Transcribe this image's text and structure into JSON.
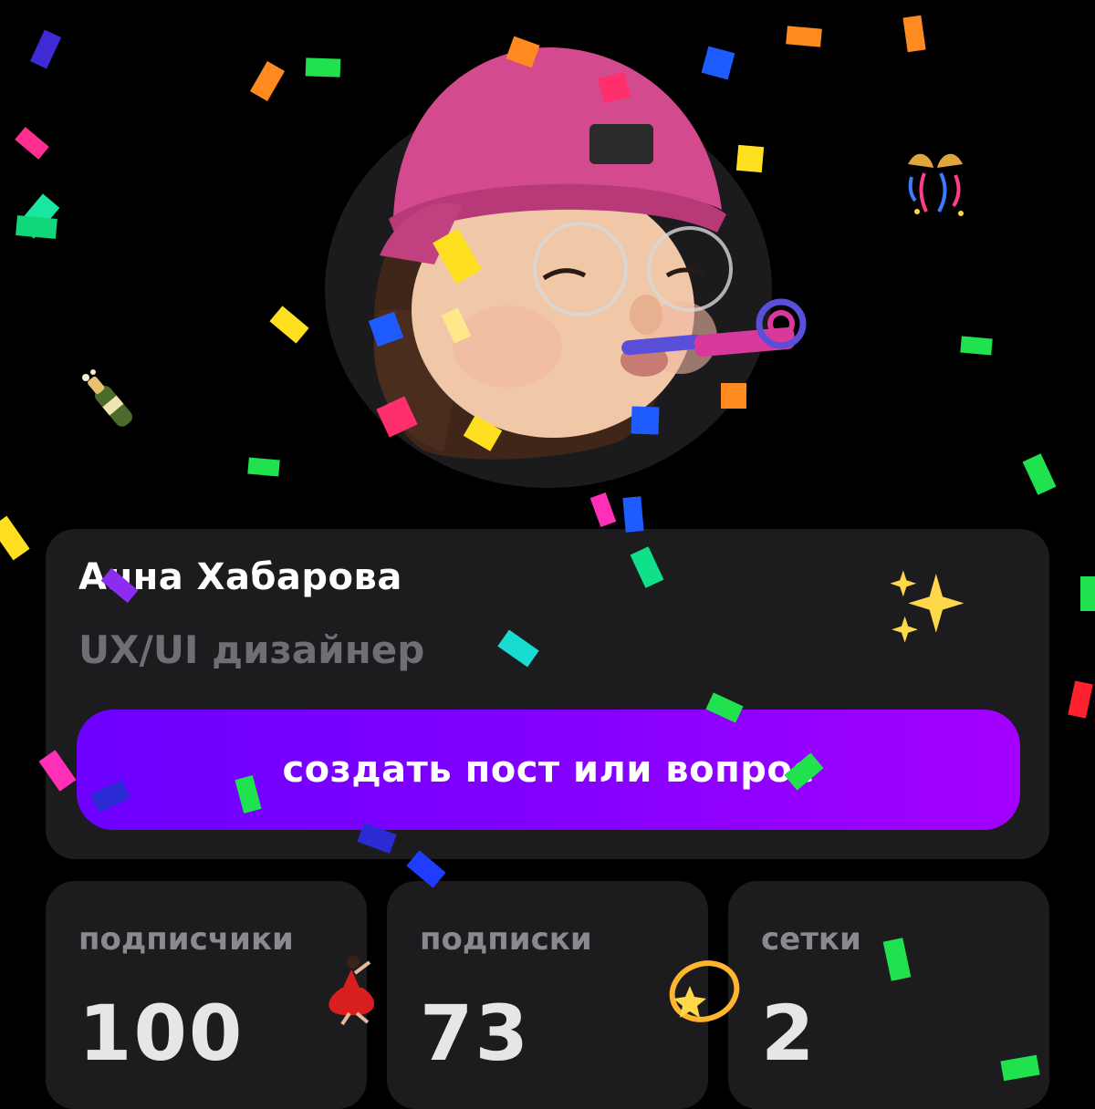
{
  "profile": {
    "name": "Анна Хабарова",
    "role": "UX/UI дизайнер",
    "create_button_label": "создать пост или вопрос"
  },
  "stats": [
    {
      "label": "подписчики",
      "value": "100"
    },
    {
      "label": "подписки",
      "value": "73"
    },
    {
      "label": "сетки",
      "value": "2"
    }
  ],
  "colors": {
    "background": "#000000",
    "card": "#1c1c1f",
    "button_gradient_start": "#6d00ff",
    "button_gradient_end": "#a400ff",
    "muted_text": "#6f6f73"
  },
  "decorations": [
    "memoji-avatar",
    "confetti",
    "sparkles-icon",
    "champagne-icon",
    "gift-ribbon-icon",
    "dancer-icon",
    "dizzy-star-icon"
  ]
}
